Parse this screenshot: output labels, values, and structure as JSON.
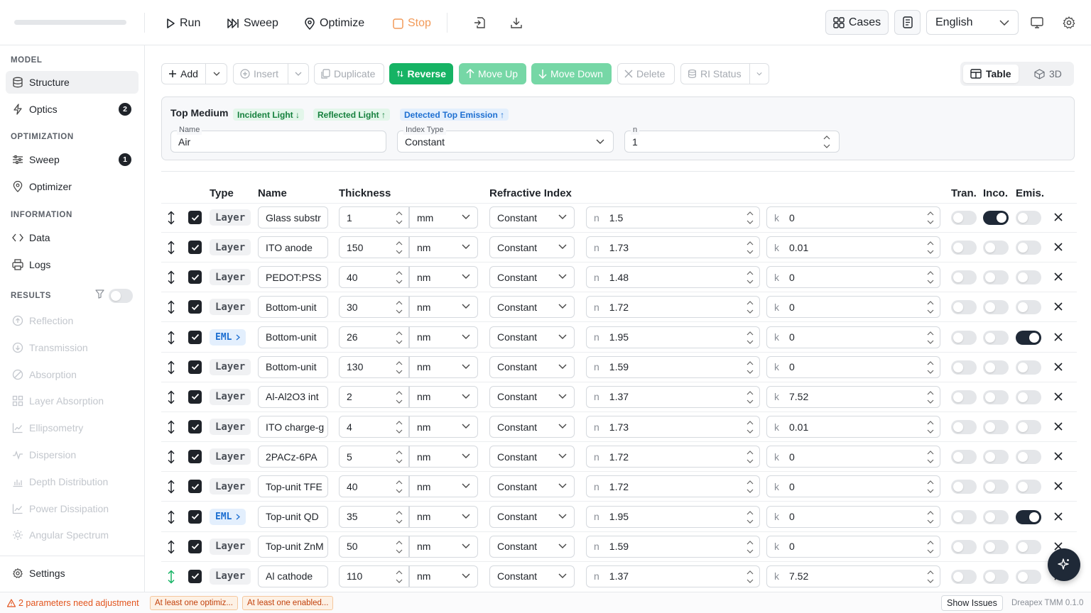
{
  "toolbar": {
    "run": "Run",
    "sweep": "Sweep",
    "optimize": "Optimize",
    "stop": "Stop",
    "cases": "Cases",
    "language": "English"
  },
  "sidebar": {
    "sections": {
      "model": "MODEL",
      "optimization": "OPTIMIZATION",
      "information": "INFORMATION",
      "results": "RESULTS"
    },
    "items": {
      "structure": "Structure",
      "optics": "Optics",
      "optics_badge": "2",
      "sweep": "Sweep",
      "sweep_badge": "1",
      "optimizer": "Optimizer",
      "data": "Data",
      "logs": "Logs",
      "settings": "Settings"
    },
    "results": [
      "Reflection",
      "Transmission",
      "Absorption",
      "Layer Absorption",
      "Ellipsometry",
      "Dispersion",
      "Depth Distribution",
      "Power Dissipation",
      "Angular Spectrum"
    ]
  },
  "actions": {
    "add": "Add",
    "insert": "Insert",
    "duplicate": "Duplicate",
    "reverse": "Reverse",
    "move_up": "Move Up",
    "move_down": "Move Down",
    "delete": "Delete",
    "ri_status": "RI Status",
    "view_table": "Table",
    "view_3d": "3D"
  },
  "top_medium": {
    "title": "Top Medium",
    "pills": [
      "Incident Light ↓",
      "Reflected Light ↑",
      "Detected Top Emission ↑"
    ],
    "name_label": "Name",
    "name_value": "Air",
    "index_type_label": "Index Type",
    "index_type_value": "Constant",
    "n_label": "n",
    "n_value": "1"
  },
  "table": {
    "headers": {
      "type": "Type",
      "name": "Name",
      "thickness": "Thickness",
      "refractive_index": "Refractive Index",
      "tran": "Tran.",
      "inco": "Inco.",
      "emis": "Emis."
    },
    "n_prefix": "n",
    "k_prefix": "k",
    "rows": [
      {
        "type": "Layer",
        "name": "Glass substr",
        "thickness": "1",
        "unit": "mm",
        "index": "Constant",
        "n": "1.5",
        "k": "0",
        "tran": false,
        "inco": true,
        "emis": false
      },
      {
        "type": "Layer",
        "name": "ITO anode",
        "thickness": "150",
        "unit": "nm",
        "index": "Constant",
        "n": "1.73",
        "k": "0.01",
        "tran": false,
        "inco": false,
        "emis": false
      },
      {
        "type": "Layer",
        "name": "PEDOT:PSS",
        "thickness": "40",
        "unit": "nm",
        "index": "Constant",
        "n": "1.48",
        "k": "0",
        "tran": false,
        "inco": false,
        "emis": false
      },
      {
        "type": "Layer",
        "name": "Bottom-unit",
        "thickness": "30",
        "unit": "nm",
        "index": "Constant",
        "n": "1.72",
        "k": "0",
        "tran": false,
        "inco": false,
        "emis": false
      },
      {
        "type": "EML",
        "name": "Bottom-unit",
        "thickness": "26",
        "unit": "nm",
        "index": "Constant",
        "n": "1.95",
        "k": "0",
        "tran": false,
        "inco": false,
        "emis": true
      },
      {
        "type": "Layer",
        "name": "Bottom-unit",
        "thickness": "130",
        "unit": "nm",
        "index": "Constant",
        "n": "1.59",
        "k": "0",
        "tran": false,
        "inco": false,
        "emis": false
      },
      {
        "type": "Layer",
        "name": "Al-Al2O3 int",
        "thickness": "2",
        "unit": "nm",
        "index": "Constant",
        "n": "1.37",
        "k": "7.52",
        "tran": false,
        "inco": false,
        "emis": false
      },
      {
        "type": "Layer",
        "name": "ITO charge-g",
        "thickness": "4",
        "unit": "nm",
        "index": "Constant",
        "n": "1.73",
        "k": "0.01",
        "tran": false,
        "inco": false,
        "emis": false
      },
      {
        "type": "Layer",
        "name": "2PACz-6PA",
        "thickness": "5",
        "unit": "nm",
        "index": "Constant",
        "n": "1.72",
        "k": "0",
        "tran": false,
        "inco": false,
        "emis": false
      },
      {
        "type": "Layer",
        "name": "Top-unit TFE",
        "thickness": "40",
        "unit": "nm",
        "index": "Constant",
        "n": "1.72",
        "k": "0",
        "tran": false,
        "inco": false,
        "emis": false
      },
      {
        "type": "EML",
        "name": "Top-unit QD",
        "thickness": "35",
        "unit": "nm",
        "index": "Constant",
        "n": "1.95",
        "k": "0",
        "tran": false,
        "inco": false,
        "emis": true
      },
      {
        "type": "Layer",
        "name": "Top-unit ZnM",
        "thickness": "50",
        "unit": "nm",
        "index": "Constant",
        "n": "1.59",
        "k": "0",
        "tran": false,
        "inco": false,
        "emis": false
      },
      {
        "type": "Layer",
        "name": "Al cathode",
        "thickness": "110",
        "unit": "nm",
        "index": "Constant",
        "n": "1.37",
        "k": "7.52",
        "tran": false,
        "inco": false,
        "emis": false
      }
    ]
  },
  "status": {
    "warning": "2 parameters need adjustment",
    "chips": [
      "At least one optimiz...",
      "At least one enabled..."
    ],
    "show_issues": "Show Issues",
    "version": "Dreapex TMM 0.1.0"
  },
  "colors": {
    "accent_green": "#16b364",
    "emis_dark": "#1f2937",
    "warning": "#e2541d"
  }
}
